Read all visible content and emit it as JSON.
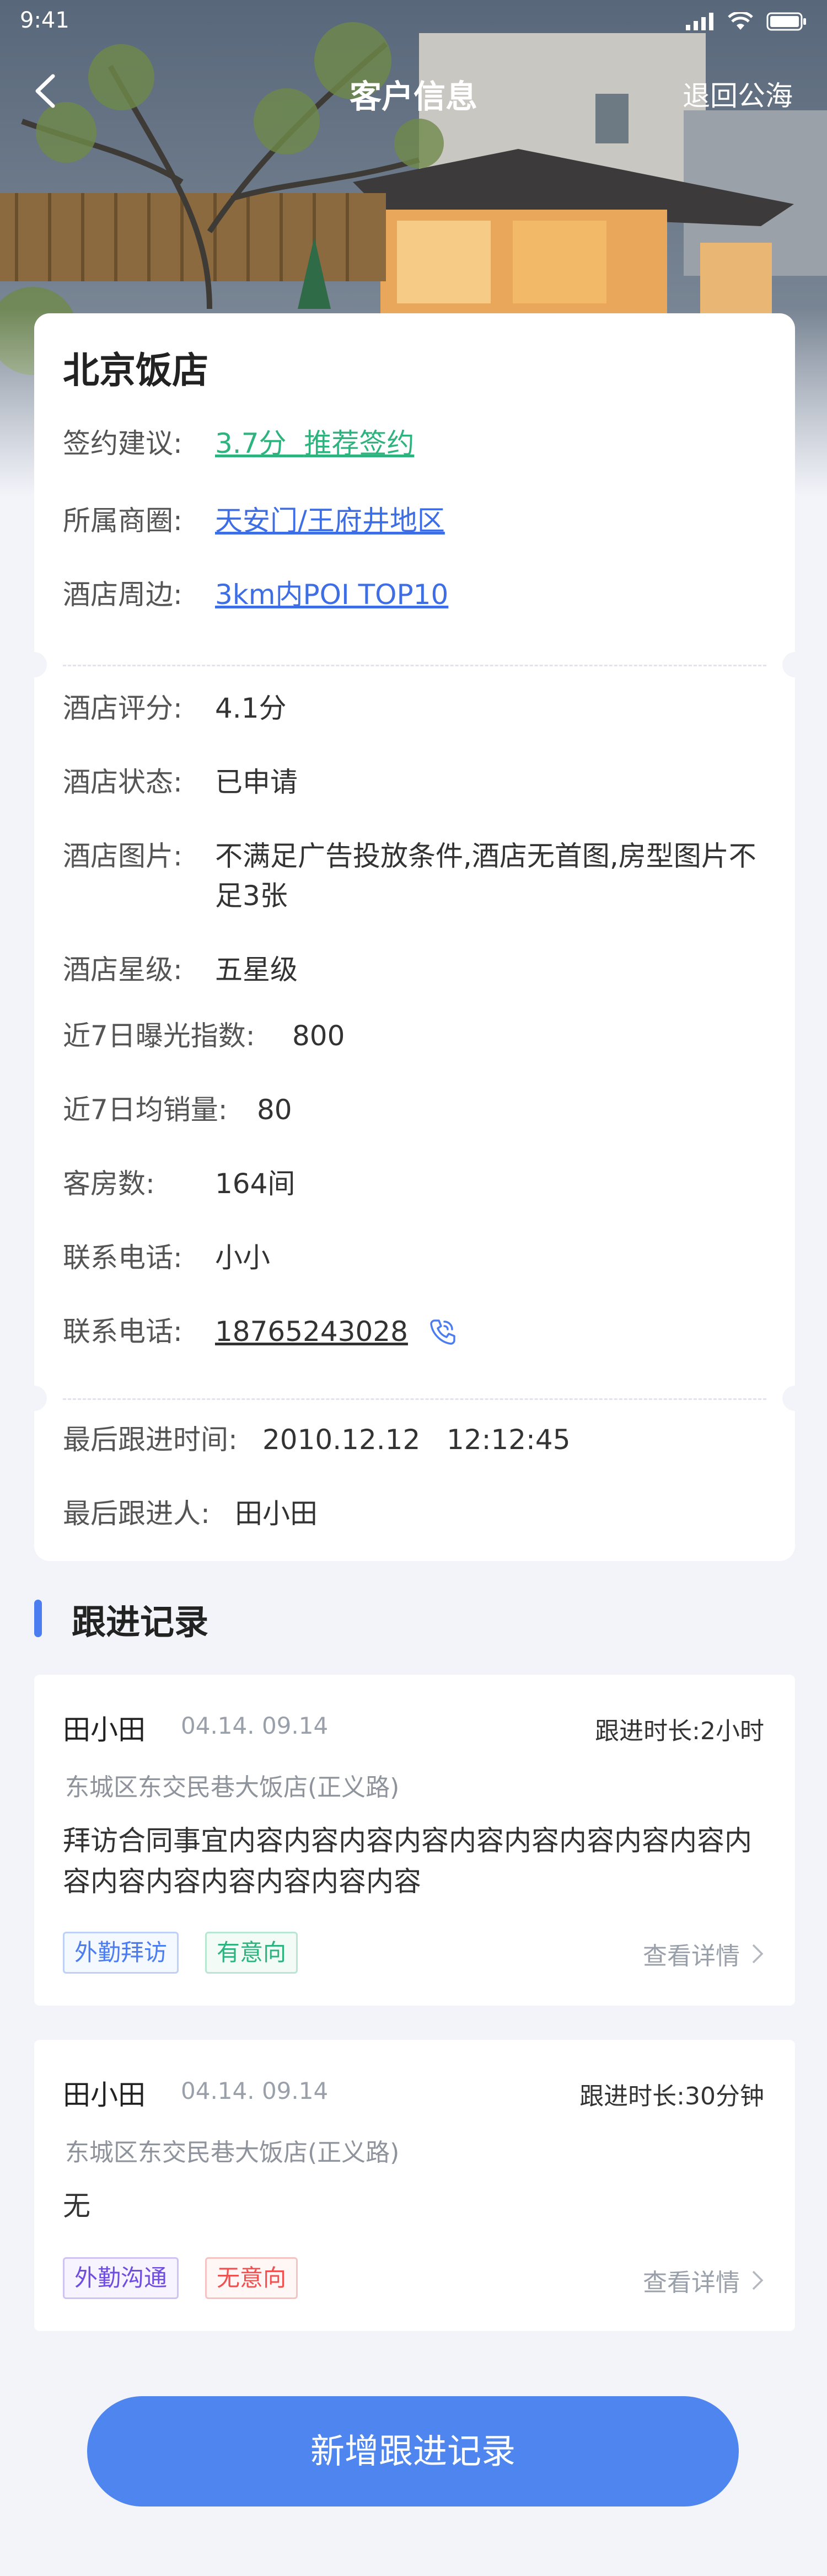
{
  "status_bar": {
    "time": "9:41"
  },
  "nav": {
    "title": "客户信息",
    "action_label": "退回公海"
  },
  "hotel": {
    "name": "北京饭店",
    "suggestion": {
      "label": "签约建议:",
      "score": "3.7分",
      "advice": "推荐签约"
    },
    "district": {
      "label": "所属商圈:",
      "value": "天安门/王府井地区"
    },
    "nearby": {
      "label": "酒店周边:",
      "value": "3km内POI TOP10"
    }
  },
  "details": [
    {
      "label": "酒店评分:",
      "value": "4.1分"
    },
    {
      "label": "酒店状态:",
      "value": "已申请"
    },
    {
      "label": "酒店图片:",
      "value": "不满足广告投放条件,酒店无首图,房型图片不足3张"
    },
    {
      "label": "酒店星级:",
      "value": "五星级"
    },
    {
      "label": "近7日曝光指数:",
      "value": "800"
    },
    {
      "label": "近7日均销量:",
      "value": "80"
    },
    {
      "label": "客房数:",
      "value": "164间"
    },
    {
      "label": "联系电话:",
      "value": "小小"
    },
    {
      "label": "联系电话:",
      "value": "18765243028"
    }
  ],
  "followup": {
    "last_time_label": "最后跟进时间:",
    "last_time_value": "2010.12.12   12:12:45",
    "last_person_label": "最后跟进人:",
    "last_person_value": "田小田"
  },
  "records_section": {
    "title": "跟进记录"
  },
  "records": [
    {
      "person": "田小田",
      "time": "04.14. 09.14",
      "duration": "跟进时长:2小时",
      "address": "东城区东交民巷大饭店(正义路)",
      "content": "拜访合同事宜内容内容内容内容内容内容内容内容内容内容内容内容内容内容内容内容",
      "tags": [
        "外勤拜访",
        "有意向"
      ],
      "detail_label": "查看详情"
    },
    {
      "person": "田小田",
      "time": "04.14. 09.14",
      "duration": "跟进时长:30分钟",
      "address": "东城区东交民巷大饭店(正义路)",
      "content": "无",
      "tags": [
        "外勤沟通",
        "无意向"
      ],
      "detail_label": "查看详情"
    }
  ],
  "add_button_label": "新增跟进记录",
  "colors": {
    "accent": "#4e85ee",
    "link_green": "#2eb37f",
    "link_blue": "#3d6ee6",
    "tag_red": "#ef5050",
    "tag_purple": "#6f4de0"
  }
}
